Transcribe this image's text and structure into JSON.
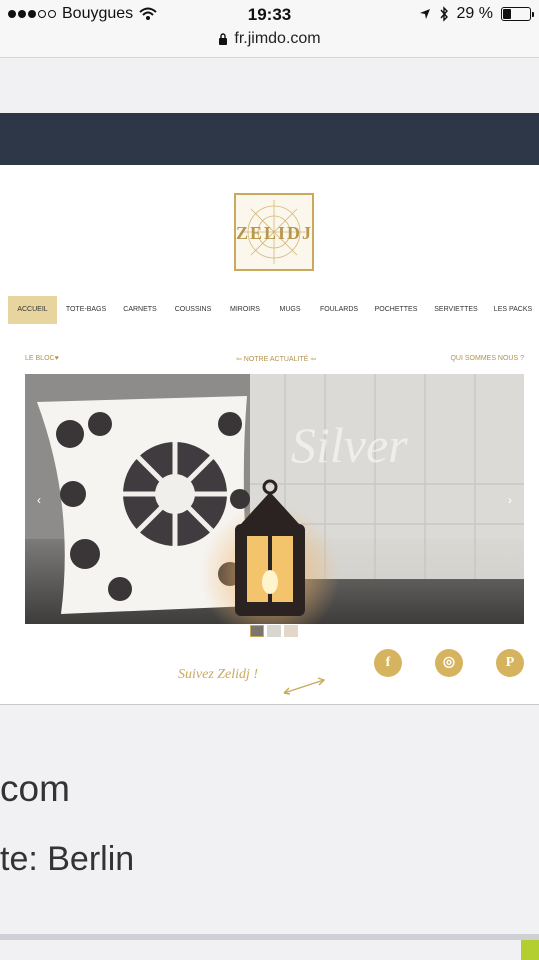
{
  "status": {
    "carrier": "Bouygues",
    "time": "19:33",
    "battery": "29 %",
    "url": "fr.jimdo.com",
    "signal_bars_filled": 3,
    "signal_bars_total": 5,
    "battery_level": 0.29
  },
  "site": {
    "logo": "ZELIDJ",
    "menu": [
      "ACCUEIL",
      "TOTE-BAGS",
      "CARNETS",
      "COUSSINS",
      "MIROIRS",
      "MUGS",
      "FOULARDS",
      "POCHETTES",
      "SERVIETTES",
      "LES PACKS"
    ],
    "subnav": {
      "left": "LE BLOC♥",
      "center": "⇦ NOTRE ACTUALITÉ ⇦",
      "right": "QUI SOMMES NOUS ?"
    },
    "slider_text": "Silver",
    "follow": "Suivez Zelidj !",
    "social": [
      "f",
      "◎",
      "P"
    ]
  },
  "page": {
    "line1": "com",
    "line2": "te: Berlin"
  },
  "colors": {
    "gold": "#c9a95c",
    "dark_band": "#2d3748",
    "menu_active": "#e7d49f"
  }
}
